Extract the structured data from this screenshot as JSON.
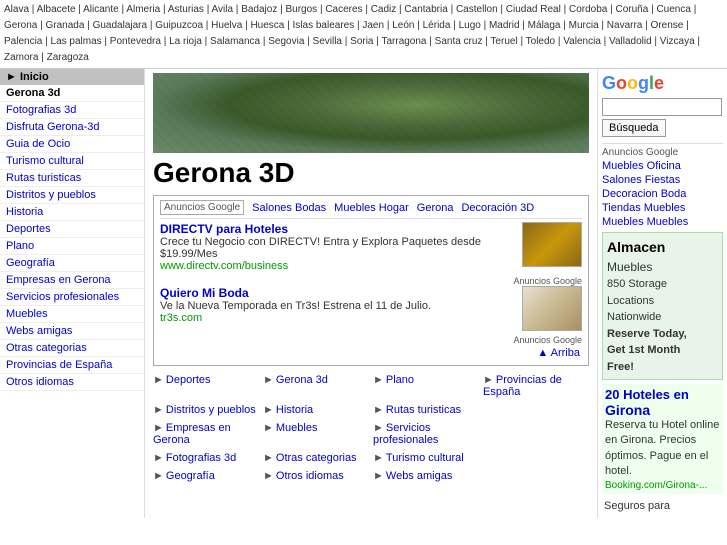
{
  "topbar": {
    "locations": [
      "Alava",
      "Albacete",
      "Alicante",
      "Almeria",
      "Asturias",
      "Avila",
      "Badajoz",
      "Burgos",
      "Caceres",
      "Cadiz",
      "Cantabria",
      "Castellon",
      "Ciudad Real",
      "Cordoba",
      "Coruña",
      "Cuenca",
      "Gerona",
      "Granada",
      "Guadalajara",
      "Guipuzcoa",
      "Huelva",
      "Huesca",
      "Islas baleares",
      "Jaen",
      "León",
      "Lérida",
      "Lugo",
      "Madrid",
      "Málaga",
      "Murcia",
      "Navarra",
      "Orense",
      "Palencia",
      "Las palmas",
      "Pontevedra",
      "La rioja",
      "Salamanca",
      "Segovia",
      "Sevilla",
      "Soria",
      "Tarragona",
      "Santa cruz",
      "Teruel",
      "Toledo",
      "Valencia",
      "Valladolid",
      "Vizcaya",
      "Zamora",
      "Zaragoza"
    ]
  },
  "sidebar": {
    "inicio_label": "► Inicio",
    "items": [
      {
        "label": "Gerona 3d",
        "active": true
      },
      {
        "label": "Fotografias 3d",
        "active": false
      },
      {
        "label": "Disfruta Gerona-3d",
        "active": false
      },
      {
        "label": "Guia de Ocio",
        "active": false
      },
      {
        "label": "Turismo cultural",
        "active": false
      },
      {
        "label": "Rutas turisticas",
        "active": false
      },
      {
        "label": "Distritos y pueblos",
        "active": false
      },
      {
        "label": "Historia",
        "active": false
      },
      {
        "label": "Deportes",
        "active": false
      },
      {
        "label": "Plano",
        "active": false
      },
      {
        "label": "Geografía",
        "active": false
      },
      {
        "label": "Empresas en Gerona",
        "active": false
      },
      {
        "label": "Servicios profesionales",
        "active": false
      },
      {
        "label": "Muebles",
        "active": false
      },
      {
        "label": "Webs amigas",
        "active": false
      },
      {
        "label": "Otras categorias",
        "active": false
      },
      {
        "label": "Provincias de España",
        "active": false
      },
      {
        "label": "Otros idiomas",
        "active": false
      }
    ]
  },
  "main": {
    "city_label": "Gerona",
    "page_title": "Gerona 3D",
    "ad_block": {
      "anuncios_google": "Anuncios Google",
      "ad_links": [
        "Salones Bodas",
        "Muebles Hogar",
        "Gerona",
        "Decoración 3D"
      ],
      "ad1": {
        "title": "DIRECTV para Hoteles",
        "desc": "Crece tu Negocio con DIRECTV! Entra y Explora Paquetes desde $19.99/Mes",
        "url": "www.directv.com/business"
      },
      "ad2": {
        "title": "Quiero Mi Boda",
        "desc": "Ve la Nueva Temporada en Tr3s! Estrena el 11 de Julio.",
        "url": "tr3s.com"
      },
      "anuncios_label": "Anuncios Google",
      "arriba": "▲ Arriba"
    },
    "link_grid": [
      {
        "label": "Deportes"
      },
      {
        "label": "Gerona 3d"
      },
      {
        "label": "Plano"
      },
      {
        "label": "Provincias de España"
      },
      {
        "label": "Distritos y pueblos"
      },
      {
        "label": "Historia"
      },
      {
        "label": "Rutas turisticas"
      },
      {
        "label": ""
      },
      {
        "label": "Empresas en Gerona"
      },
      {
        "label": "Muebles"
      },
      {
        "label": "Servicios profesionales"
      },
      {
        "label": ""
      },
      {
        "label": "Fotografias 3d"
      },
      {
        "label": "Otras categorias"
      },
      {
        "label": "Turismo cultural"
      },
      {
        "label": ""
      },
      {
        "label": "Geografía"
      },
      {
        "label": "Otros idiomas"
      },
      {
        "label": "Webs amigas"
      },
      {
        "label": ""
      }
    ]
  },
  "right_sidebar": {
    "google_logo": "Google",
    "search_placeholder": "",
    "search_button": "Búsqueda",
    "anuncios_google": "Anuncios Google",
    "right_ads": [
      {
        "label": "Muebles Oficina"
      },
      {
        "label": "Salones Fiestas"
      },
      {
        "label": "Decoracion Boda"
      },
      {
        "label": "Tiendas Muebles"
      },
      {
        "label": "Muebles Muebles"
      }
    ],
    "almacen_ad": {
      "title": "Almacen",
      "subtitle": "Muebles",
      "detail1": "850 Storage",
      "detail2": "Locations",
      "detail3": "Nationwide",
      "detail4": "Reserve Today,",
      "detail5": "Get 1st Month",
      "detail6": "Free!"
    },
    "hotel_ad": {
      "title": "20 Hoteles en",
      "city": "Girona",
      "text": "Reserva tu Hotel online en Girona. Precios óptimos. Pague en el hotel.",
      "url": "Booking.com/Girona-..."
    },
    "seguros_label": "Seguros para"
  }
}
